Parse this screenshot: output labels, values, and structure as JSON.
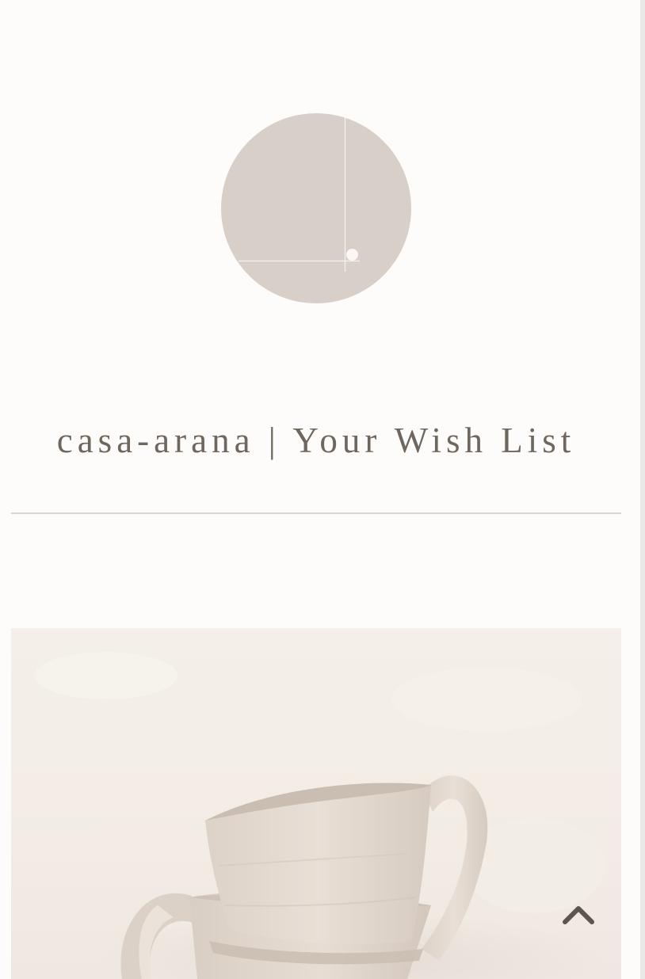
{
  "header": {
    "logo_icon": "circle-monogram-logo",
    "title": "casa-arana | Your Wish List"
  },
  "colors": {
    "background": "#fefcfb",
    "title_text": "#6f665e",
    "logo_fill": "#d8d0c8",
    "divider": "#d9d5d2",
    "hero_background": "#f3ede6",
    "arrow": "#5c5550"
  },
  "main": {
    "hero_image": "stacked-clay-mugs-image"
  },
  "controls": {
    "back_to_top_icon": "chevron-up-icon"
  }
}
